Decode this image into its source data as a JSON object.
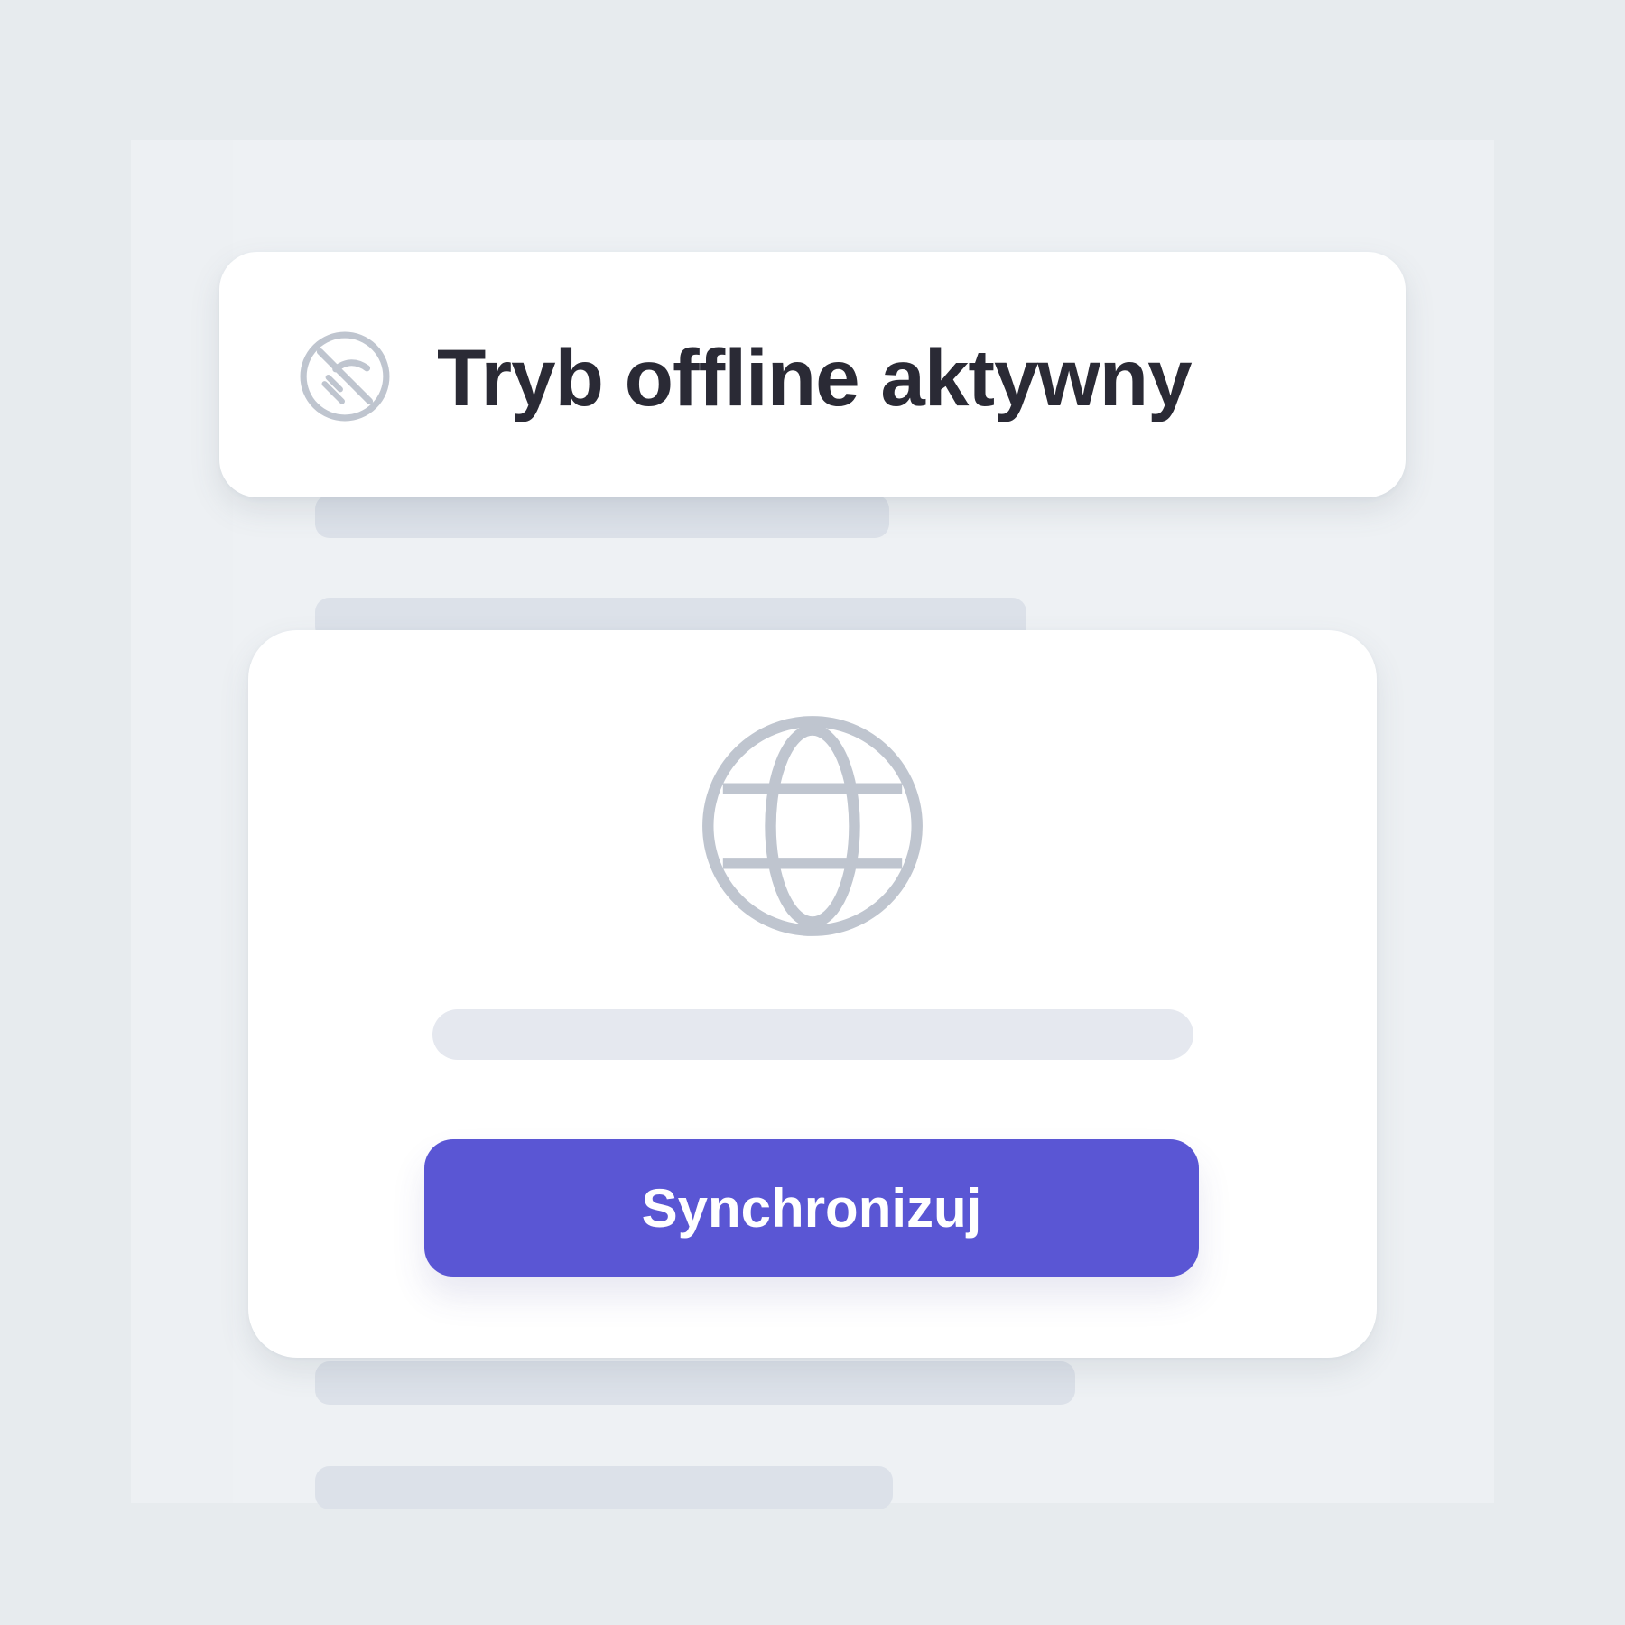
{
  "banner": {
    "title": "Tryb offline aktywny",
    "icon": "wifi-off-icon"
  },
  "card": {
    "icon": "globe-icon",
    "progress": 0,
    "button_label": "Synchronizuj"
  },
  "colors": {
    "background": "#e7ebee",
    "card": "#ffffff",
    "text": "#2a2a35",
    "muted_icon": "#bfc5cf",
    "skeleton": "#dce1e9",
    "accent": "#5a56d4"
  }
}
